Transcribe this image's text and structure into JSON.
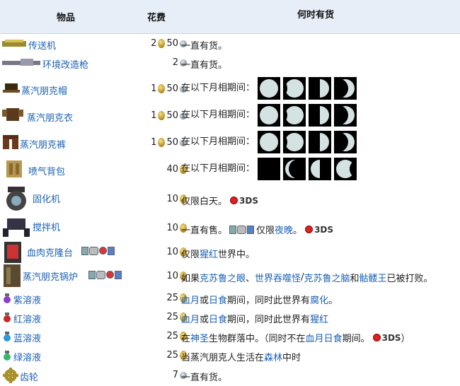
{
  "headers": {
    "item": "物品",
    "cost": "花费",
    "when": "何时有货"
  },
  "rows": [
    {
      "name": "传送机",
      "gold": "2",
      "silver": "50",
      "text": "一直有货。"
    },
    {
      "name": "环境改造枪",
      "gold": "",
      "silver": "2",
      "text": "一直有货。"
    },
    {
      "name": "蒸汽朋克帽",
      "gold": "1",
      "silver": "50",
      "text": "在以下月相期间："
    },
    {
      "name": "蒸汽朋克衣",
      "gold": "1",
      "silver": "50",
      "text": "在以下月相期间："
    },
    {
      "name": "蒸汽朋克裤",
      "gold": "1",
      "silver": "50",
      "text": "在以下月相期间："
    },
    {
      "name": "喷气背包",
      "gold": "",
      "silver": "40",
      "text": "在以下月相期间："
    },
    {
      "name": "固化机",
      "gold": "",
      "silver": "10",
      "text": "仅限白天。",
      "tag": "3DS"
    },
    {
      "name": "搅拌机",
      "gold": "",
      "silver": "10",
      "text": "一直有售。",
      "text2": "仅限",
      "link": "夜晚",
      "text3": "。",
      "tag": "3DS"
    },
    {
      "name": "血肉克隆台",
      "gold": "",
      "silver": "10",
      "text": "仅限",
      "link": "猩红",
      "text3": "世界中。"
    },
    {
      "name": "蒸汽朋克锅炉",
      "gold": "",
      "silver": "10",
      "text": "如果",
      "link": "克苏鲁之眼",
      "text_a": "、",
      "link2": "世界吞噬怪",
      "text_b": "/",
      "link3": "克苏鲁之脑",
      "text_c": "和",
      "link4": "骷髅王",
      "text_d": "已被打败。"
    },
    {
      "name": "紫溶液",
      "gold": "",
      "silver": "25",
      "link": "血月",
      "text": "或",
      "link2": "日食",
      "text_a": "期间，同时此世界有",
      "link3": "腐化",
      "text_b": "。"
    },
    {
      "name": "红溶液",
      "gold": "",
      "silver": "25",
      "link": "血月",
      "text": "或",
      "link2": "日食",
      "text_a": "期间，同时此世界有",
      "link3": "猩红"
    },
    {
      "name": "蓝溶液",
      "gold": "",
      "silver": "25",
      "text": "在",
      "link": "神圣",
      "text_a": "生物群落中。（同时不在",
      "link2": "血月",
      "link3": "日食",
      "text_b": "期间。",
      "tag": "3DS",
      "text_c": "）"
    },
    {
      "name": "绿溶液",
      "gold": "",
      "silver": "25",
      "text": "当蒸汽朋克人生活在",
      "link": "森林",
      "text_a": "中时"
    },
    {
      "name": "齿轮",
      "gold": "",
      "silver": "7",
      "text": "一直有货。"
    }
  ],
  "moons": {
    "full": "full-moon",
    "waning": "waning-gibbous",
    "third": "third-quarter",
    "crescent": "waning-crescent",
    "new": "new-moon"
  }
}
